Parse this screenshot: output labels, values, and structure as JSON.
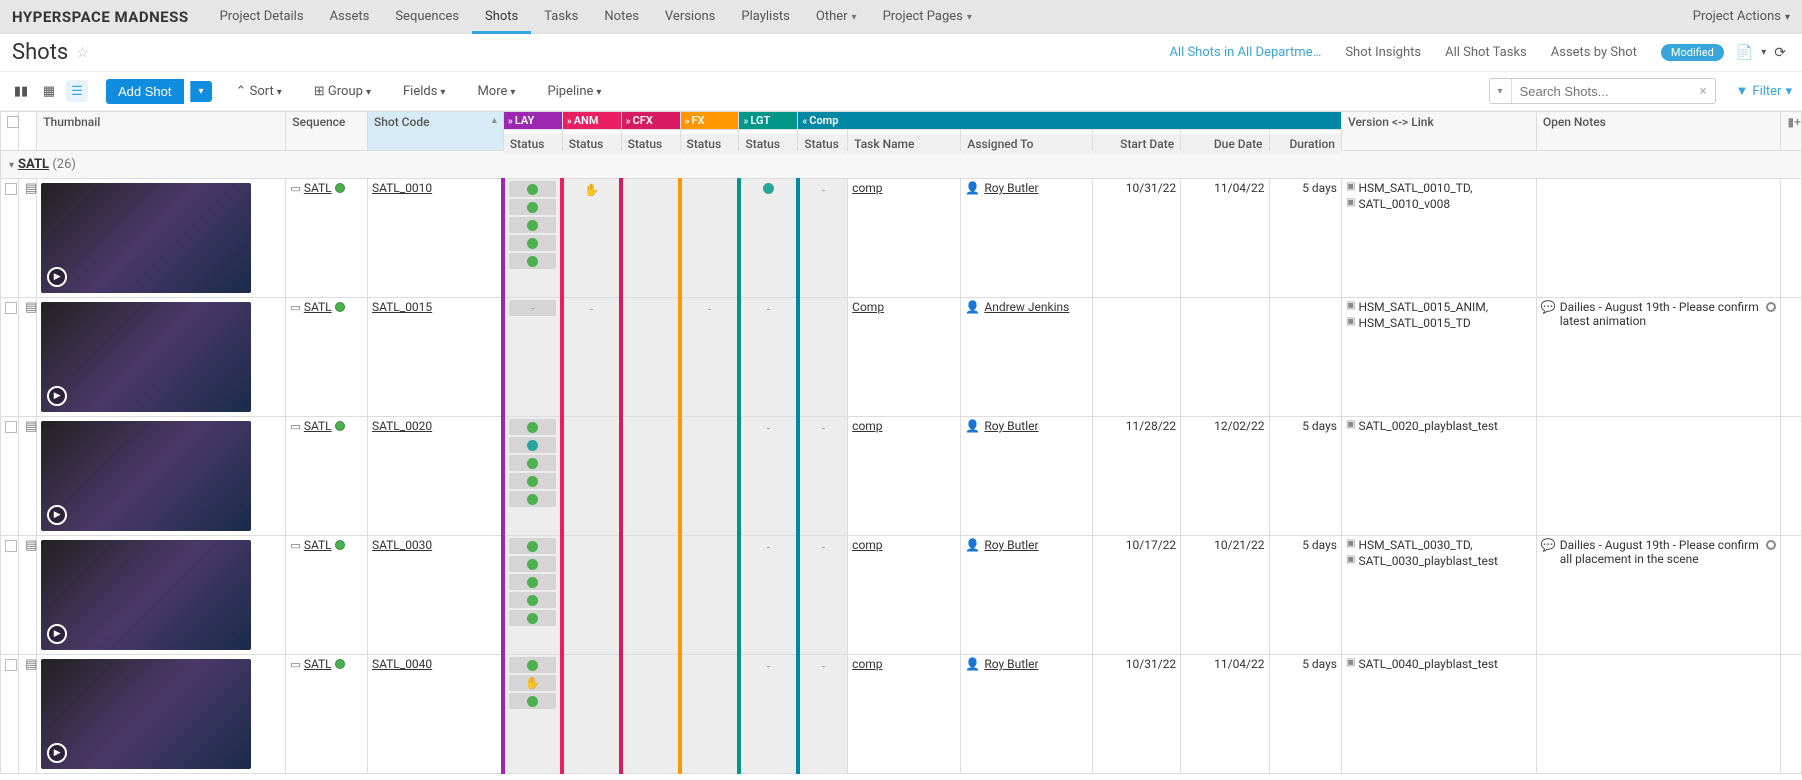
{
  "project": "HYPERSPACE MADNESS",
  "nav": {
    "tabs": [
      "Project Details",
      "Assets",
      "Sequences",
      "Shots",
      "Tasks",
      "Notes",
      "Versions",
      "Playlists",
      "Other",
      "Project Pages"
    ],
    "active": "Shots",
    "dropdown_tabs": [
      "Other",
      "Project Pages"
    ]
  },
  "project_actions": "Project Actions",
  "page": {
    "title": "Shots",
    "links": {
      "all_shots": "All Shots in All Departme…",
      "insights": "Shot Insights",
      "tasks": "All Shot Tasks",
      "assets": "Assets by Shot"
    },
    "badge": "Modified"
  },
  "toolbar": {
    "add": "Add Shot",
    "sort": "Sort",
    "group": "Group",
    "fields": "Fields",
    "more": "More",
    "pipeline": "Pipeline",
    "search_placeholder": "Search Shots...",
    "filter": "Filter"
  },
  "columns": {
    "thumbnail": "Thumbnail",
    "sequence": "Sequence",
    "shot_code": "Shot Code",
    "status": "Status",
    "task_name": "Task Name",
    "assigned": "Assigned To",
    "start": "Start Date",
    "due": "Due Date",
    "duration": "Duration",
    "version": "Version <-> Link",
    "notes": "Open Notes"
  },
  "steps": {
    "lay": "LAY",
    "anm": "ANM",
    "cfx": "CFX",
    "fx": "FX",
    "lgt": "LGT",
    "comp": "Comp"
  },
  "group": {
    "name": "SATL",
    "count": 26,
    "caret": "▾"
  },
  "rows": [
    {
      "sequence": "SATL",
      "code": "SATL_0010",
      "lay": [
        "green",
        "green",
        "green",
        "green",
        "green"
      ],
      "anm": "hand",
      "cfx": "",
      "fx": "",
      "lgt": "teal",
      "comp": {
        "status": "-",
        "task": "comp",
        "assigned": "Roy Butler",
        "start": "10/31/22",
        "due": "11/04/22",
        "dur": "5 days"
      },
      "versions": [
        "HSM_SATL_0010_TD,",
        "SATL_0010_v008"
      ],
      "notes": ""
    },
    {
      "sequence": "SATL",
      "code": "SATL_0015",
      "lay": [
        "dash"
      ],
      "anm": "dash",
      "cfx": "",
      "fx": "dash",
      "lgt": "dash",
      "comp": {
        "status": "",
        "task": "Comp",
        "assigned": "Andrew Jenkins",
        "start": "",
        "due": "",
        "dur": ""
      },
      "versions": [
        "HSM_SATL_0015_ANIM,",
        "HSM_SATL_0015_TD"
      ],
      "notes": "Dailies - August 19th - Please confirm latest animation"
    },
    {
      "sequence": "SATL",
      "code": "SATL_0020",
      "lay": [
        "green",
        "teal",
        "green",
        "green",
        "green"
      ],
      "anm": "",
      "cfx": "",
      "fx": "",
      "lgt": "dash",
      "comp": {
        "status": "-",
        "task": "comp",
        "assigned": "Roy Butler",
        "start": "11/28/22",
        "due": "12/02/22",
        "dur": "5 days"
      },
      "versions": [
        "SATL_0020_playblast_test"
      ],
      "notes": ""
    },
    {
      "sequence": "SATL",
      "code": "SATL_0030",
      "lay": [
        "green",
        "green",
        "green",
        "green",
        "green"
      ],
      "anm": "",
      "cfx": "",
      "fx": "",
      "lgt": "dash",
      "comp": {
        "status": "-",
        "task": "comp",
        "assigned": "Roy Butler",
        "start": "10/17/22",
        "due": "10/21/22",
        "dur": "5 days"
      },
      "versions": [
        "HSM_SATL_0030_TD,",
        "SATL_0030_playblast_test"
      ],
      "notes": "Dailies - August 19th - Please confirm all placement in the scene"
    },
    {
      "sequence": "SATL",
      "code": "SATL_0040",
      "lay": [
        "green",
        "hand",
        "green"
      ],
      "anm": "",
      "cfx": "",
      "fx": "",
      "lgt": "dash",
      "comp": {
        "status": "-",
        "task": "comp",
        "assigned": "Roy Butler",
        "start": "10/31/22",
        "due": "11/04/22",
        "dur": "5 days"
      },
      "versions": [
        "SATL_0040_playblast_test"
      ],
      "notes": ""
    }
  ]
}
